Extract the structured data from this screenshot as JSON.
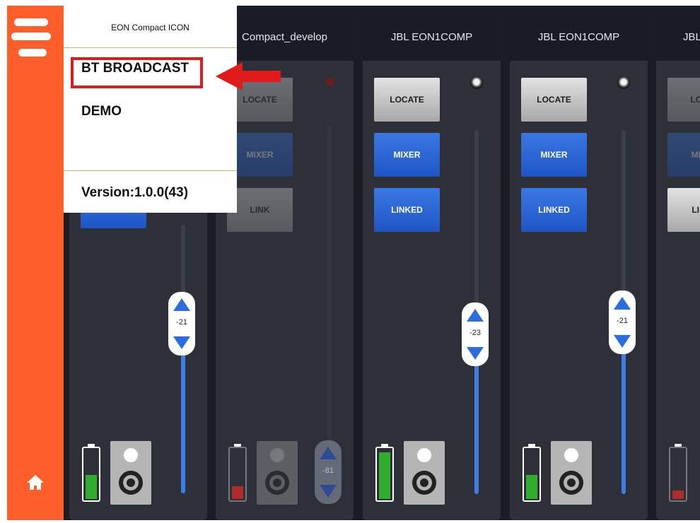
{
  "menu": {
    "title": "EON Compact ICON",
    "items": [
      "BT BROADCAST",
      "DEMO"
    ],
    "version": "Version:1.0.0(43)"
  },
  "channels": [
    {
      "name": "",
      "buttons": [
        "",
        "",
        ""
      ],
      "fader_value": "-21",
      "battery_segments": 2
    },
    {
      "name": "Compact_develop",
      "buttons": [
        "LOCATE",
        "MIXER",
        "LINK"
      ],
      "fader_value": "-81",
      "battery_segments": 1,
      "state": "offline"
    },
    {
      "name": "JBL EON1COMP",
      "buttons": [
        "LOCATE",
        "MIXER",
        "LINKED"
      ],
      "fader_value": "-23",
      "battery_segments": 3
    },
    {
      "name": "JBL EON1COMP",
      "buttons": [
        "LOCATE",
        "MIXER",
        "LINKED"
      ],
      "fader_value": "-21",
      "battery_segments": 2
    },
    {
      "name": "JBL",
      "buttons": [
        "LO",
        "MI",
        "LI"
      ],
      "battery_segments": 1,
      "state": "offline"
    }
  ],
  "colors": {
    "accent_orange": "#fd5e2a",
    "button_blue": "#2a66d8",
    "highlight_red": "#e11b1b",
    "battery_green": "#2ead2e",
    "battery_red": "#b02b2b"
  },
  "icons": {
    "menu": "hamburger-icon",
    "home": "home-icon",
    "annotation": "red-arrow-icon"
  }
}
